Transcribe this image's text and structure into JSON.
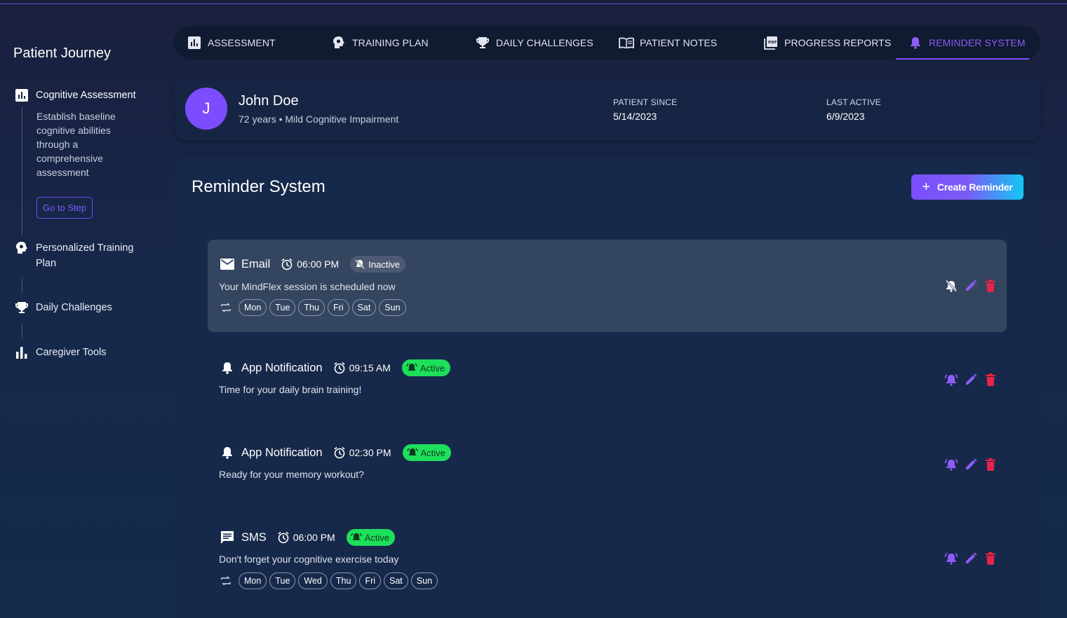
{
  "sidebar": {
    "title": "Patient Journey",
    "steps": [
      {
        "label": "Cognitive Assessment",
        "icon": "bar-chart-icon",
        "active": true
      },
      {
        "label": "Personalized Training Plan",
        "icon": "brain-gear-icon"
      },
      {
        "label": "Daily Challenges",
        "icon": "trophy-icon"
      },
      {
        "label": "Caregiver Tools",
        "icon": "bar-chart-icon"
      }
    ],
    "active_description": "Establish baseline cognitive abilities through a comprehensive assessment",
    "goto_label": "Go to Step"
  },
  "tabs": [
    {
      "label": "ASSESSMENT",
      "icon": "assessment-icon"
    },
    {
      "label": "TRAINING PLAN",
      "icon": "brain-gear-icon"
    },
    {
      "label": "DAILY CHALLENGES",
      "icon": "trophy-icon"
    },
    {
      "label": "PATIENT NOTES",
      "icon": "book-icon"
    },
    {
      "label": "PROGRESS REPORTS",
      "icon": "pdf-icon"
    },
    {
      "label": "REMINDER SYSTEM",
      "icon": "bell-icon",
      "active": true
    }
  ],
  "patient": {
    "initial": "J",
    "name": "John Doe",
    "subtitle": "72 years • Mild Cognitive Impairment",
    "since_label": "PATIENT SINCE",
    "since_value": "5/14/2023",
    "active_label": "LAST ACTIVE",
    "active_value": "6/9/2023"
  },
  "reminders_panel": {
    "title": "Reminder System",
    "create_label": "Create Reminder",
    "reminders": [
      {
        "type": "Email",
        "time": "06:00 PM",
        "status": "Inactive",
        "message": "Your MindFlex session is scheduled now",
        "days": [
          "Mon",
          "Tue",
          "Thu",
          "Fri",
          "Sat",
          "Sun"
        ]
      },
      {
        "type": "App Notification",
        "time": "09:15 AM",
        "status": "Active",
        "message": "Time for your daily brain training!",
        "days": []
      },
      {
        "type": "App Notification",
        "time": "02:30 PM",
        "status": "Active",
        "message": "Ready for your memory workout?",
        "days": []
      },
      {
        "type": "SMS",
        "time": "06:00 PM",
        "status": "Active",
        "message": "Don't forget your cognitive exercise today",
        "days": [
          "Mon",
          "Tue",
          "Wed",
          "Thu",
          "Fri",
          "Sat",
          "Sun"
        ]
      }
    ]
  },
  "colors": {
    "accent": "#7c4dff",
    "active_badge": "#1de05a",
    "delete": "#e8234a",
    "inactive_badge": "#4c5a72"
  }
}
